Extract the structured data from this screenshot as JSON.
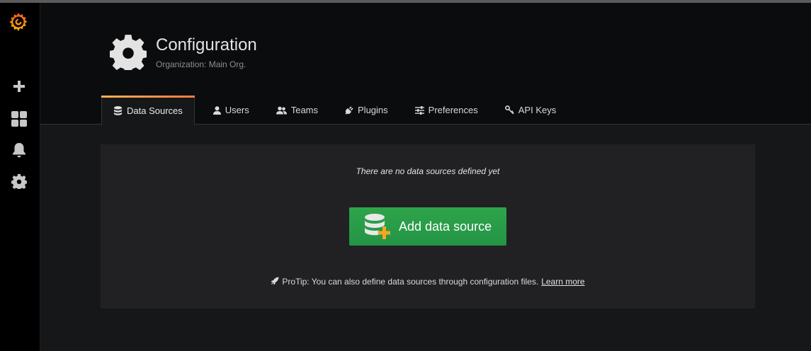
{
  "sidebar": {
    "logo": "grafana-logo-icon",
    "items": [
      {
        "icon": "plus-icon"
      },
      {
        "icon": "dashboards-icon"
      },
      {
        "icon": "bell-icon"
      },
      {
        "icon": "gear-icon"
      }
    ]
  },
  "header": {
    "icon": "gear-icon",
    "title": "Configuration",
    "subtitle": "Organization: Main Org."
  },
  "tabs": [
    {
      "label": "Data Sources",
      "icon": "database-icon",
      "active": true
    },
    {
      "label": "Users",
      "icon": "user-icon",
      "active": false
    },
    {
      "label": "Teams",
      "icon": "users-icon",
      "active": false
    },
    {
      "label": "Plugins",
      "icon": "plug-icon",
      "active": false
    },
    {
      "label": "Preferences",
      "icon": "sliders-icon",
      "active": false
    },
    {
      "label": "API Keys",
      "icon": "key-icon",
      "active": false
    }
  ],
  "main": {
    "empty_message": "There are no data sources defined yet",
    "add_button_label": "Add data source",
    "protip_text": "ProTip: You can also define data sources through configuration files.",
    "learn_more": "Learn more"
  },
  "colors": {
    "accent_gradient_start": "#ffb357",
    "accent_gradient_end": "#ff7941",
    "button_green": "#299c46",
    "sidebar_bg": "#000000",
    "panel_bg": "#212124"
  }
}
